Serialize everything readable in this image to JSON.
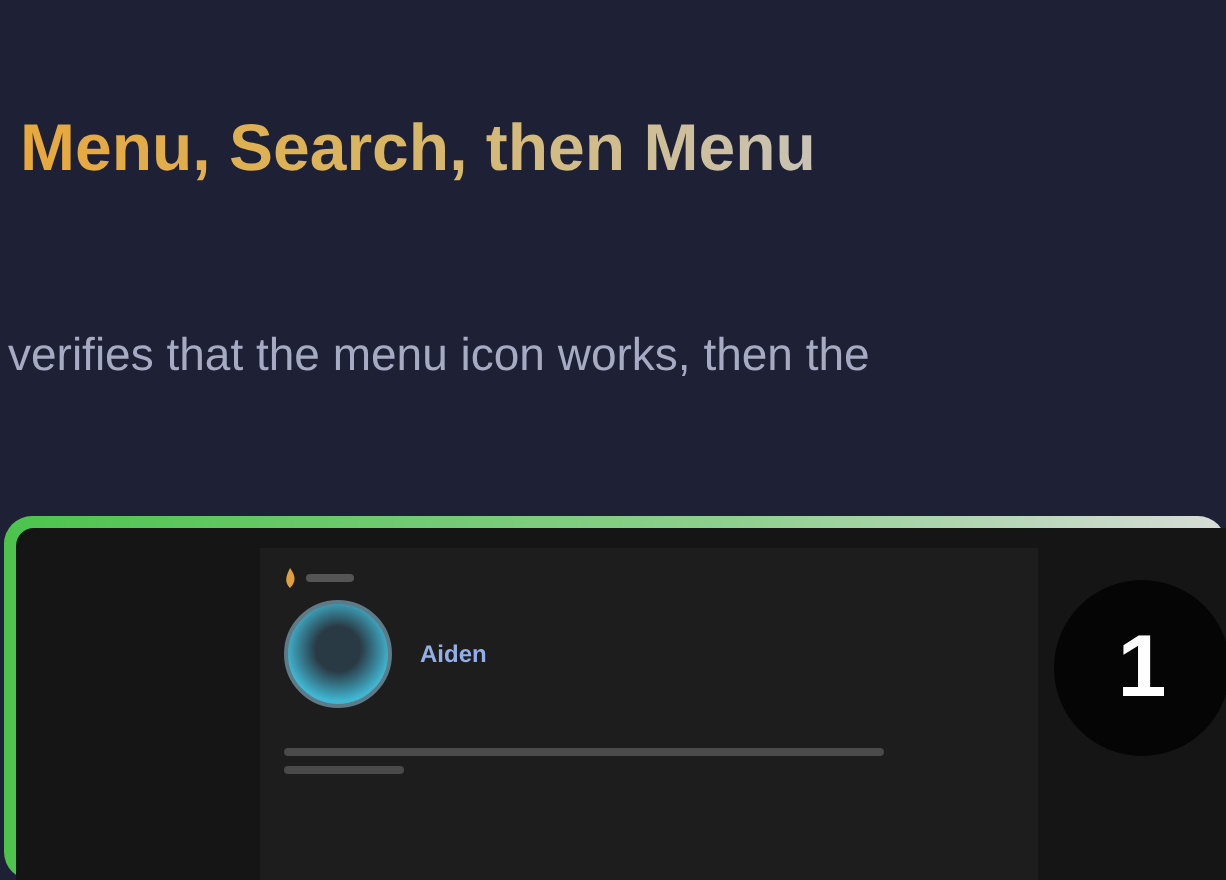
{
  "heading": "Menu, Search, then Menu",
  "description": "verifies that the menu icon works, then the",
  "preview": {
    "user_name": "Aiden",
    "step_badge": "1",
    "passed": true
  }
}
